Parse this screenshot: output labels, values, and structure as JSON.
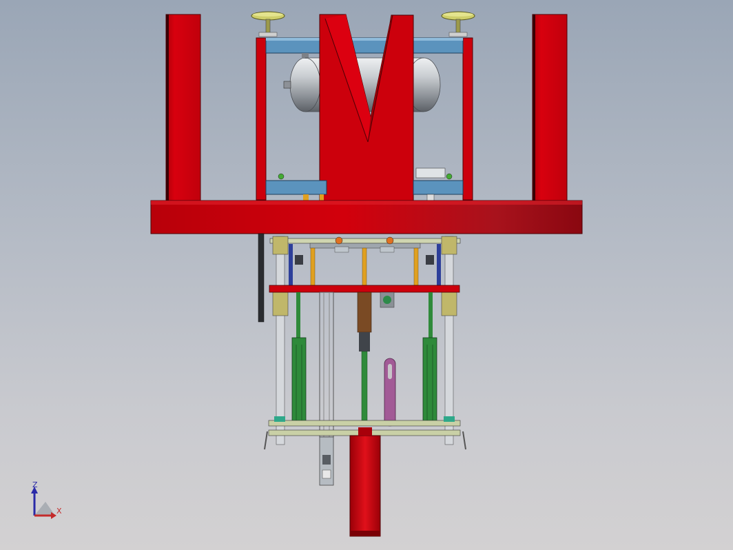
{
  "viewport": {
    "background_top": "#9aa6b6",
    "background_bottom": "#d3d1d2"
  },
  "model": {
    "frame_color": "#c8000a",
    "plate_color": "#5b93bd",
    "tank_color": "#b8bcc0",
    "rod_color": "#2f8a3a",
    "bolt_color": "#e0a020",
    "guide_color": "#c0b76a"
  },
  "triad": {
    "z_label": "Z",
    "x_label": "X",
    "z_color": "#2a2aa8",
    "x_color": "#c42a2a"
  }
}
